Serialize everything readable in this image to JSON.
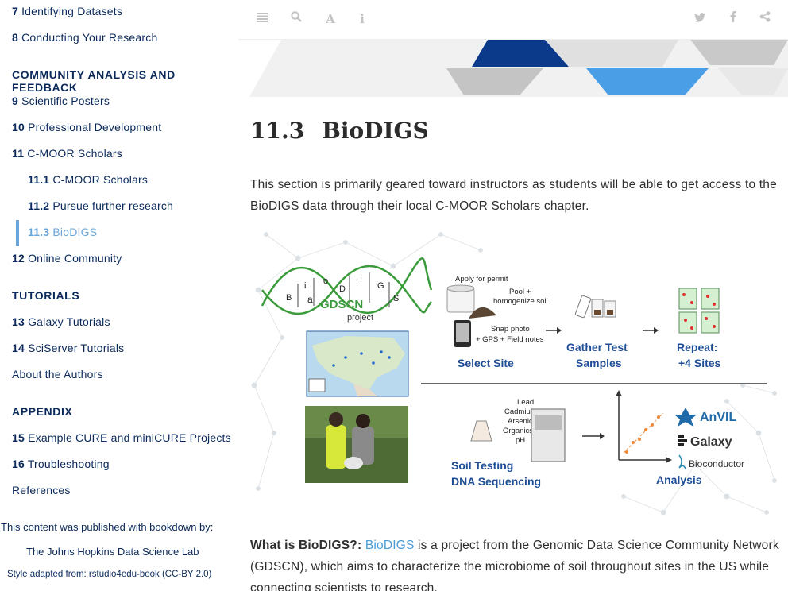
{
  "sidebar": {
    "items": [
      {
        "num": "7",
        "label": "Identifying Datasets"
      },
      {
        "num": "8",
        "label": "Conducting Your Research"
      },
      {
        "num": "9",
        "label": "Scientific Posters"
      },
      {
        "num": "10",
        "label": "Professional Development"
      },
      {
        "num": "11",
        "label": "C-MOOR Scholars"
      },
      {
        "num": "11.1",
        "label": "C-MOOR Scholars"
      },
      {
        "num": "11.2",
        "label": "Pursue further research"
      },
      {
        "num": "11.3",
        "label": "BioDIGS"
      },
      {
        "num": "12",
        "label": "Online Community"
      },
      {
        "num": "13",
        "label": "Galaxy Tutorials"
      },
      {
        "num": "14",
        "label": "SciServer Tutorials"
      },
      {
        "num": "",
        "label": "About the Authors"
      },
      {
        "num": "15",
        "label": "Example CURE and miniCURE Projects"
      },
      {
        "num": "16",
        "label": "Troubleshooting"
      },
      {
        "num": "",
        "label": "References"
      }
    ],
    "sections": {
      "community": "COMMUNITY ANALYSIS AND FEEDBACK",
      "tutorials": "TUTORIALS",
      "appendix": "APPENDIX"
    },
    "published_by": "This content was published with bookdown by:",
    "publisher": "The Johns Hopkins Data Science Lab",
    "style_note": "Style adapted from: rstudio4edu-book (CC-BY 2.0)"
  },
  "toolbar": {
    "icons": [
      "list-icon",
      "search-icon",
      "font-icon",
      "info-icon",
      "twitter-icon",
      "facebook-icon",
      "share-icon"
    ],
    "colors": {
      "icon": "#c2c2c2"
    }
  },
  "main": {
    "section_number": "11.3",
    "section_title": "BioDIGS",
    "intro": "This section is primarily geared toward instructors as students will be able to get access to the BioDIGS data through their local C-MOOR Scholars chapter.",
    "what_is_label": "What is BioDIGS?:",
    "what_is_link": "BioDIGS",
    "what_is_text": " is a project from the Genomic Data Science Community Network (GDSCN), which aims to characterize the microbiome of soil throughout sites in the US while connecting scientists to research."
  },
  "figure": {
    "logo_letters": [
      "B",
      "i",
      "o",
      "D",
      "I",
      "G",
      "S"
    ],
    "logo_a": "a",
    "logo_main": "GDSCN",
    "logo_sub": "project",
    "apply_permit": "Apply for permit",
    "pool": "Pool +",
    "homogenize": "homogenize soil",
    "snap_photo": "Snap photo",
    "gps": "+ GPS + Field notes",
    "select_site": "Select Site",
    "gather1": "Gather Test",
    "gather2": "Samples",
    "repeat1": "Repeat:",
    "repeat2": "+4 Sites",
    "elements": [
      "Lead",
      "Cadmium",
      "Arsenic",
      "Organics",
      "pH"
    ],
    "soil_testing": "Soil Testing",
    "dna_seq": "DNA Sequencing",
    "analysis": "Analysis",
    "anvil": "AnVIL",
    "galaxy": "Galaxy",
    "bioconductor": "Bioconductor"
  },
  "colors": {
    "nav_dark": "#0b2a5b",
    "active": "#6aa6d9",
    "link": "#4a9ad5",
    "figure_blue": "#1f4e96",
    "figure_green": "#3a9b3a",
    "banner_navy": "#0b3a8a",
    "banner_light": "#4a9ee6"
  }
}
